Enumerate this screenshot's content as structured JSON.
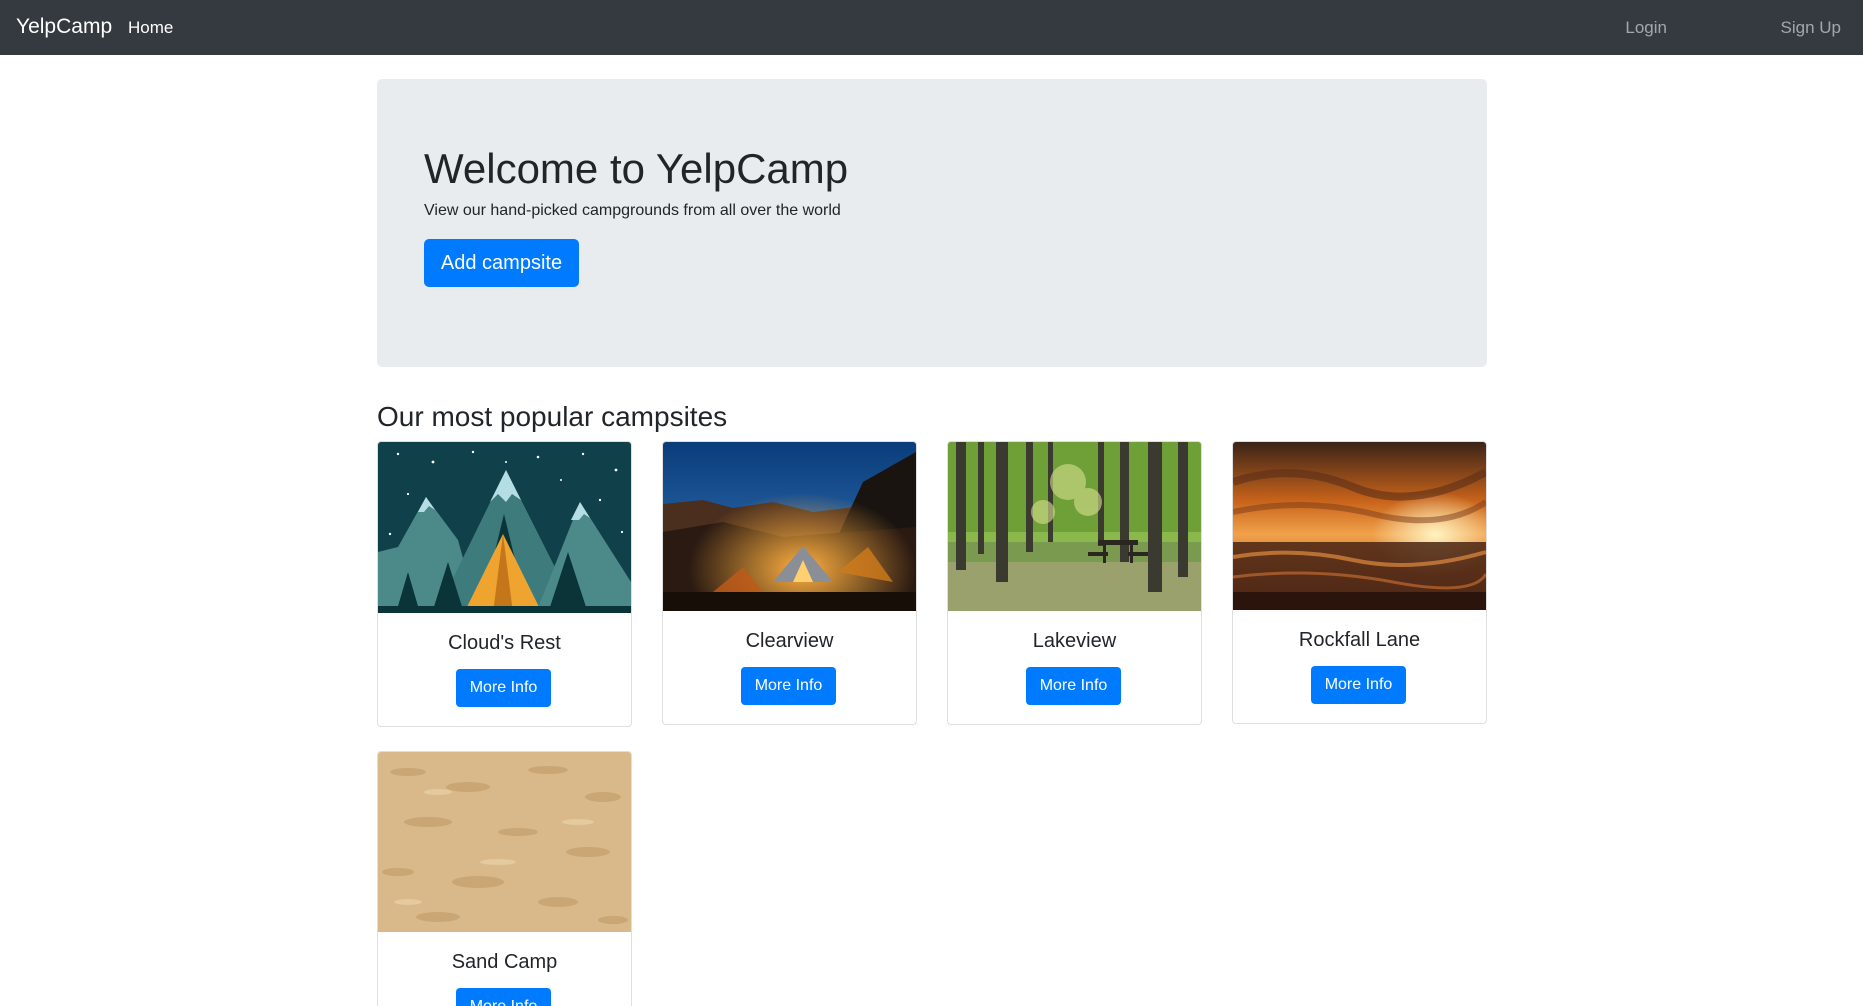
{
  "navbar": {
    "brand": "YelpCamp",
    "links": [
      {
        "label": "Home"
      },
      {
        "label": "Login"
      },
      {
        "label": "Sign Up"
      }
    ]
  },
  "hero": {
    "title": "Welcome to YelpCamp",
    "subtitle": "View our hand-picked campgrounds from all over the world",
    "button_label": "Add campsite"
  },
  "section": {
    "title": "Our most popular campsites"
  },
  "campgrounds": [
    {
      "name": "Cloud's Rest",
      "image": "tent-mountains-illustration",
      "button_label": "More Info"
    },
    {
      "name": "Clearview",
      "image": "tent-night-canyon-photo",
      "button_label": "More Info"
    },
    {
      "name": "Lakeview",
      "image": "forest-picnic-table-photo",
      "button_label": "More Info"
    },
    {
      "name": "Rockfall Lane",
      "image": "ocean-sunset-photo",
      "button_label": "More Info"
    },
    {
      "name": "Sand Camp",
      "image": "sand-texture-photo",
      "button_label": "More Info"
    }
  ],
  "colors": {
    "navbar_bg": "#343a40",
    "jumbotron_bg": "#e9ecef",
    "primary": "#007bff"
  }
}
